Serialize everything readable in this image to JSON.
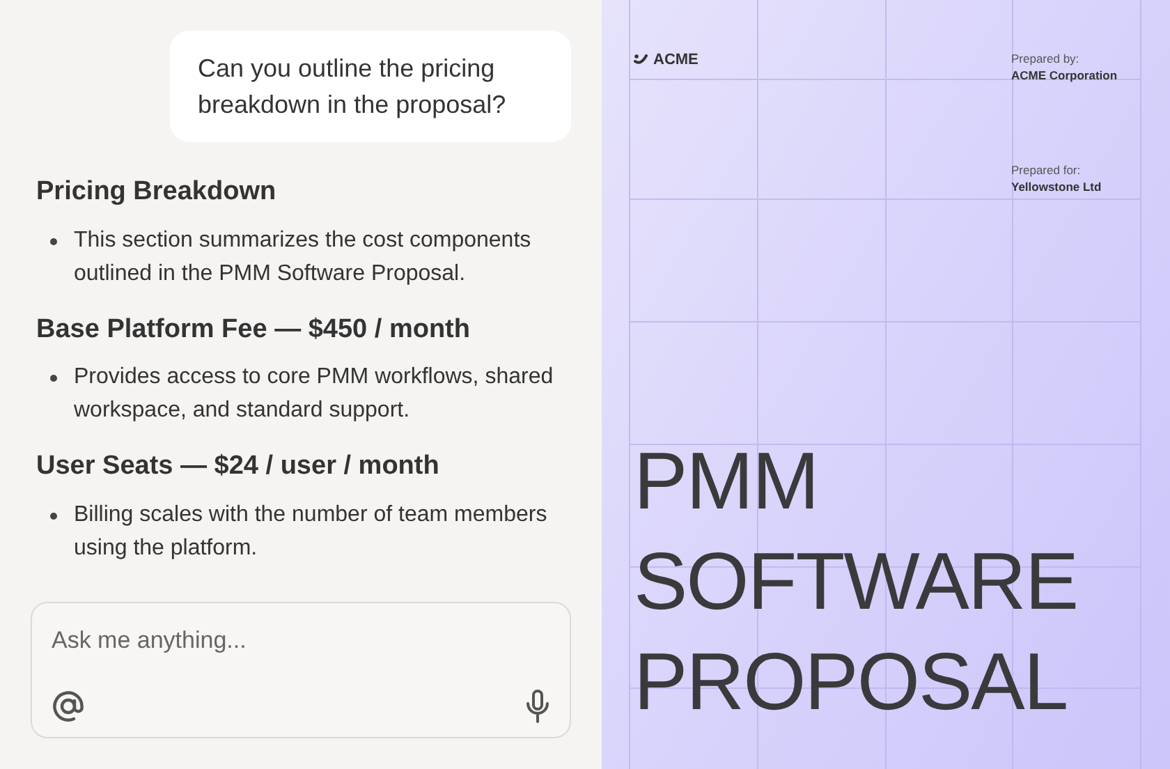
{
  "chat": {
    "user_message": "Can you outline the pricing breakdown in the proposal?",
    "response": [
      {
        "kind": "heading",
        "text": "Pricing Breakdown"
      },
      {
        "kind": "bullet",
        "text": "This section summarizes the cost components outlined in the PMM Software Proposal."
      },
      {
        "kind": "heading",
        "text": "Base Platform Fee — $450 / month"
      },
      {
        "kind": "bullet",
        "text": "Provides access to core PMM workflows, shared workspace, and standard support."
      },
      {
        "kind": "heading",
        "text": "User Seats — $24 / user / month"
      },
      {
        "kind": "bullet",
        "text": "Billing scales with the number of team members using the platform."
      }
    ]
  },
  "composer": {
    "placeholder": "Ask me anything..."
  },
  "document": {
    "logo": "ACME",
    "prepared_by_label": "Prepared by:",
    "prepared_by": "ACME Corporation",
    "prepared_for_label": "Prepared for:",
    "prepared_for": "Yellowstone Ltd",
    "title_lines": [
      "PMM",
      "SOFTWARE",
      "PROPOSAL"
    ]
  }
}
